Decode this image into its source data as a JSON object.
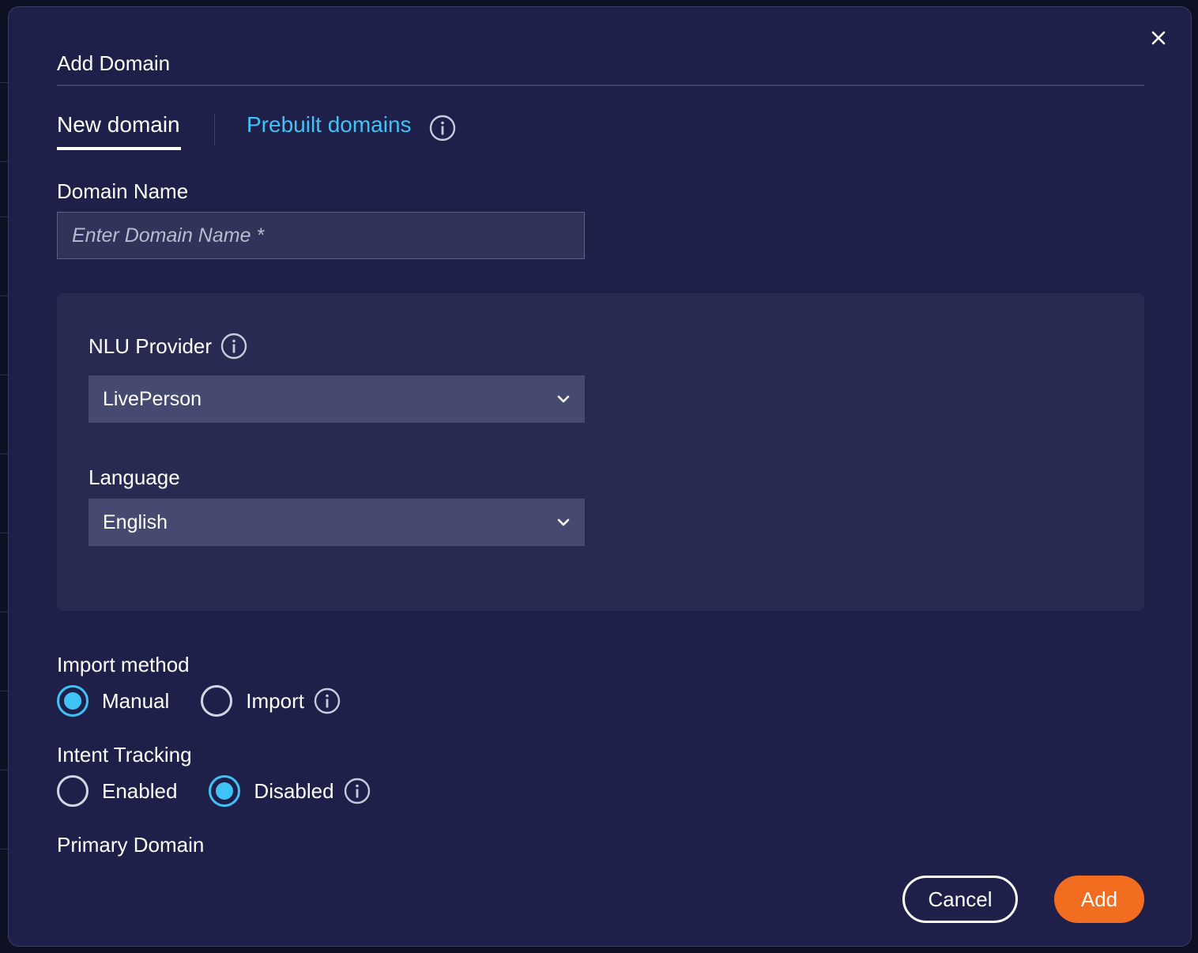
{
  "dialog": {
    "title": "Add Domain",
    "close_icon": "close-icon"
  },
  "tabs": {
    "new_domain": "New domain",
    "prebuilt_domains": "Prebuilt domains",
    "active": "New domain",
    "info_icon": "info-icon"
  },
  "domain_name": {
    "label": "Domain Name",
    "placeholder": "Enter Domain Name *",
    "value": ""
  },
  "nlu_provider": {
    "label": "NLU Provider",
    "selected": "LivePerson",
    "info_icon": "info-icon"
  },
  "language": {
    "label": "Language",
    "selected": "English"
  },
  "import_method": {
    "label": "Import method",
    "options": [
      {
        "label": "Manual",
        "checked": true
      },
      {
        "label": "Import",
        "checked": false
      }
    ],
    "info_icon": "info-icon"
  },
  "intent_tracking": {
    "label": "Intent Tracking",
    "options": [
      {
        "label": "Enabled",
        "checked": false
      },
      {
        "label": "Disabled",
        "checked": true
      }
    ],
    "info_icon": "info-icon"
  },
  "primary_domain": {
    "label": "Primary Domain"
  },
  "actions": {
    "cancel_label": "Cancel",
    "add_label": "Add"
  },
  "colors": {
    "background": "#1f2049",
    "panel": "#292a52",
    "accent": "#3fc3f7",
    "primary_button": "#f26d1f",
    "select_bg": "#474a70"
  }
}
